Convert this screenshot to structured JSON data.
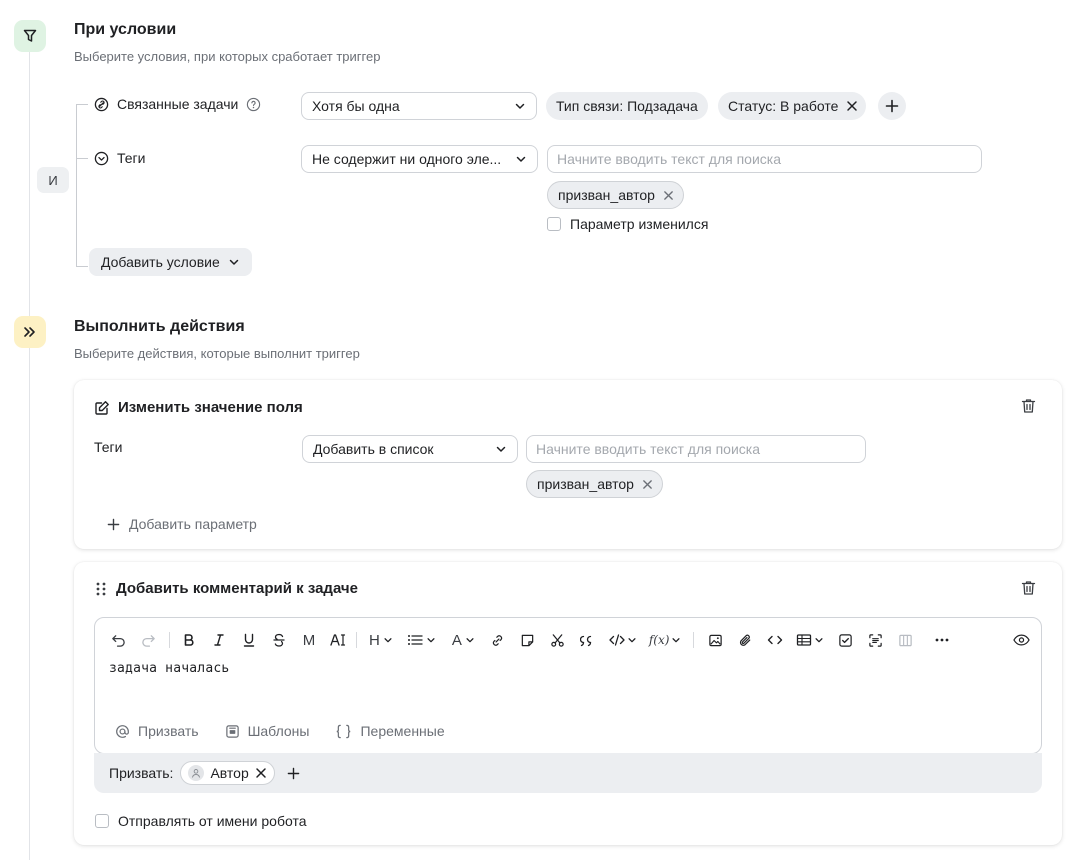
{
  "conditions": {
    "title": "При условии",
    "subtitle": "Выберите условия, при которых сработает триггер",
    "and_label": "И",
    "linked_tasks": {
      "label": "Связанные задачи",
      "select_value": "Хотя бы одна",
      "chips": [
        "Тип связи: Подзадача",
        "Статус: В работе"
      ]
    },
    "tags": {
      "label": "Теги",
      "select_value": "Не содержит ни одного эле...",
      "search_placeholder": "Начните вводить текст для поиска",
      "chip": "призван_автор",
      "checkbox_label": "Параметр изменился"
    },
    "add_condition_label": "Добавить условие"
  },
  "actions": {
    "title": "Выполнить действия",
    "subtitle": "Выберите действия, которые выполнит триггер",
    "change_field": {
      "title": "Изменить значение поля",
      "field_label": "Теги",
      "select_value": "Добавить в список",
      "search_placeholder": "Начните вводить текст для поиска",
      "chip": "призван_автор",
      "add_param_label": "Добавить параметр"
    },
    "comment": {
      "title": "Добавить комментарий к задаче",
      "text": "задача  началась",
      "footer": {
        "mention": "Призвать",
        "templates": "Шаблоны",
        "variables": "Переменные"
      },
      "mention_label": "Призвать:",
      "mention_chip": "Автор",
      "robot_checkbox_label": "Отправлять от имени робота",
      "toolbar": {
        "heading": "H",
        "mono": "M",
        "font_color": "A",
        "fx": "f(x)"
      }
    }
  }
}
